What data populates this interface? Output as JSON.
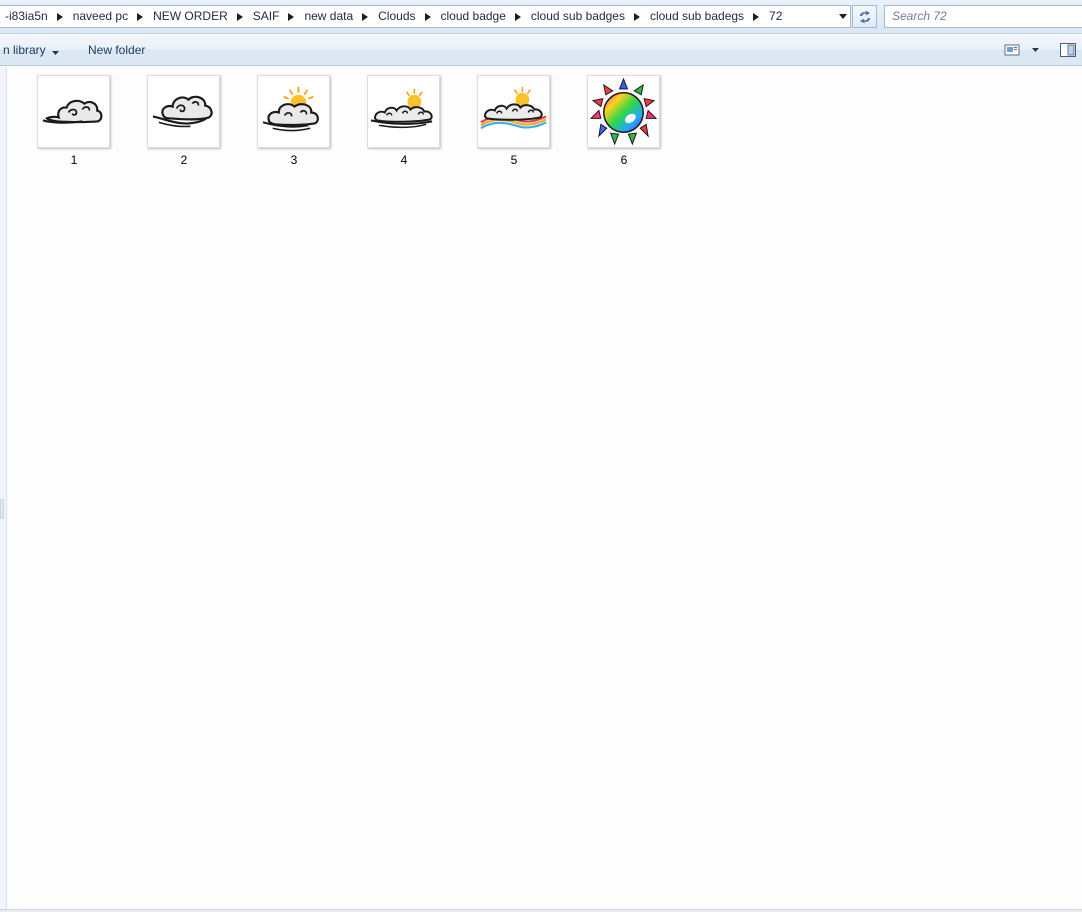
{
  "address_bar": {
    "crumbs": [
      "-i83ia5n",
      "naveed pc",
      "NEW ORDER",
      "SAIF",
      "new data",
      "Clouds",
      "cloud badge",
      "cloud sub badges",
      "cloud sub badegs",
      "72"
    ]
  },
  "search": {
    "placeholder": "Search 72"
  },
  "toolbar": {
    "library_label": "n library",
    "new_folder_label": "New folder"
  },
  "files": [
    {
      "name": "1",
      "icon": "cloud-icon"
    },
    {
      "name": "2",
      "icon": "cloud-icon"
    },
    {
      "name": "3",
      "icon": "cloud-sun-icon"
    },
    {
      "name": "4",
      "icon": "cloud-sun-icon"
    },
    {
      "name": "5",
      "icon": "cloud-sun-rainbow-icon"
    },
    {
      "name": "6",
      "icon": "rainbow-sun-icon"
    }
  ],
  "colors": {
    "accent": "#1e395b",
    "sun": "#f7b21b",
    "toolbar_bg": "#dce7f4"
  }
}
